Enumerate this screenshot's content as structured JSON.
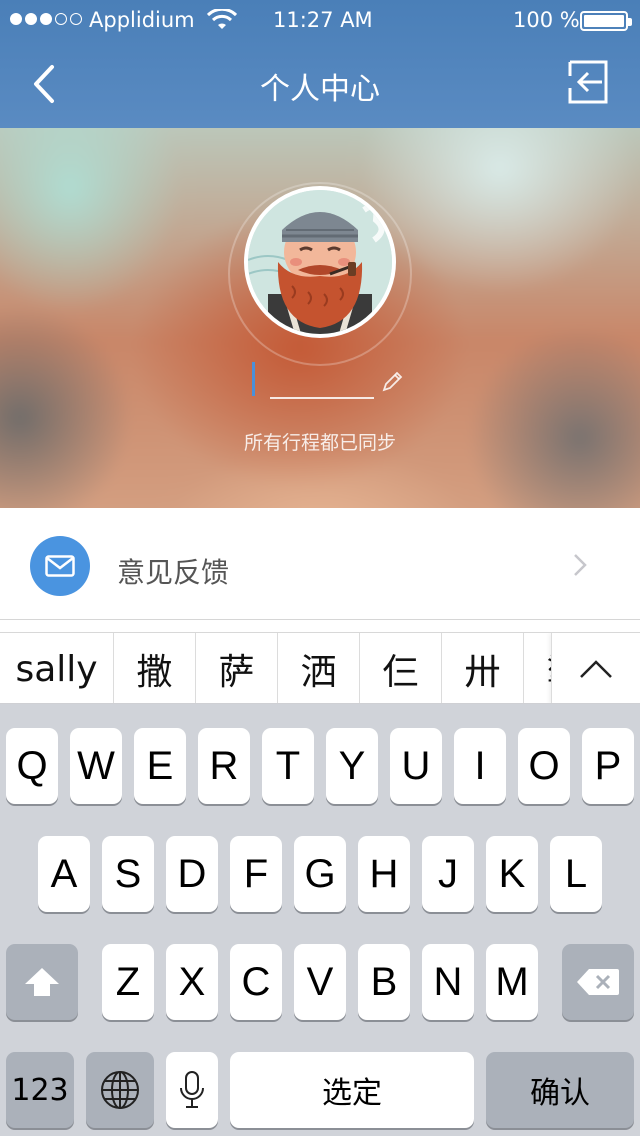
{
  "status_bar": {
    "signal_dots_filled": 3,
    "signal_dots_total": 5,
    "carrier": "Applidium",
    "time": "11:27 AM",
    "battery": "100 %"
  },
  "nav": {
    "title": "个人中心",
    "back_icon": "chevron-left-icon",
    "logout_icon": "logout-icon"
  },
  "profile": {
    "avatar_alt": "bearded-sailor-avatar",
    "name_value": "",
    "sync_status": "所有行程都已同步"
  },
  "list": {
    "items": [
      {
        "label": "意见反馈",
        "icon": "mail-icon"
      }
    ]
  },
  "candidates": {
    "items": [
      "sally",
      "撒",
      "萨",
      "洒",
      "仨",
      "卅",
      "挲"
    ],
    "expand_icon": "chevron-up-icon"
  },
  "keyboard": {
    "row1": [
      "Q",
      "W",
      "E",
      "R",
      "T",
      "Y",
      "U",
      "I",
      "O",
      "P"
    ],
    "row2": [
      "A",
      "S",
      "D",
      "F",
      "G",
      "H",
      "J",
      "K",
      "L"
    ],
    "row3": [
      "Z",
      "X",
      "C",
      "V",
      "B",
      "N",
      "M"
    ],
    "numbers_label": "123",
    "space_label": "选定",
    "return_label": "确认"
  },
  "colors": {
    "nav_blue": "#4a7fb8",
    "accent_blue": "#4a94e0",
    "keyboard_bg": "#d0d3d9",
    "key_gray": "#abb1ba"
  }
}
